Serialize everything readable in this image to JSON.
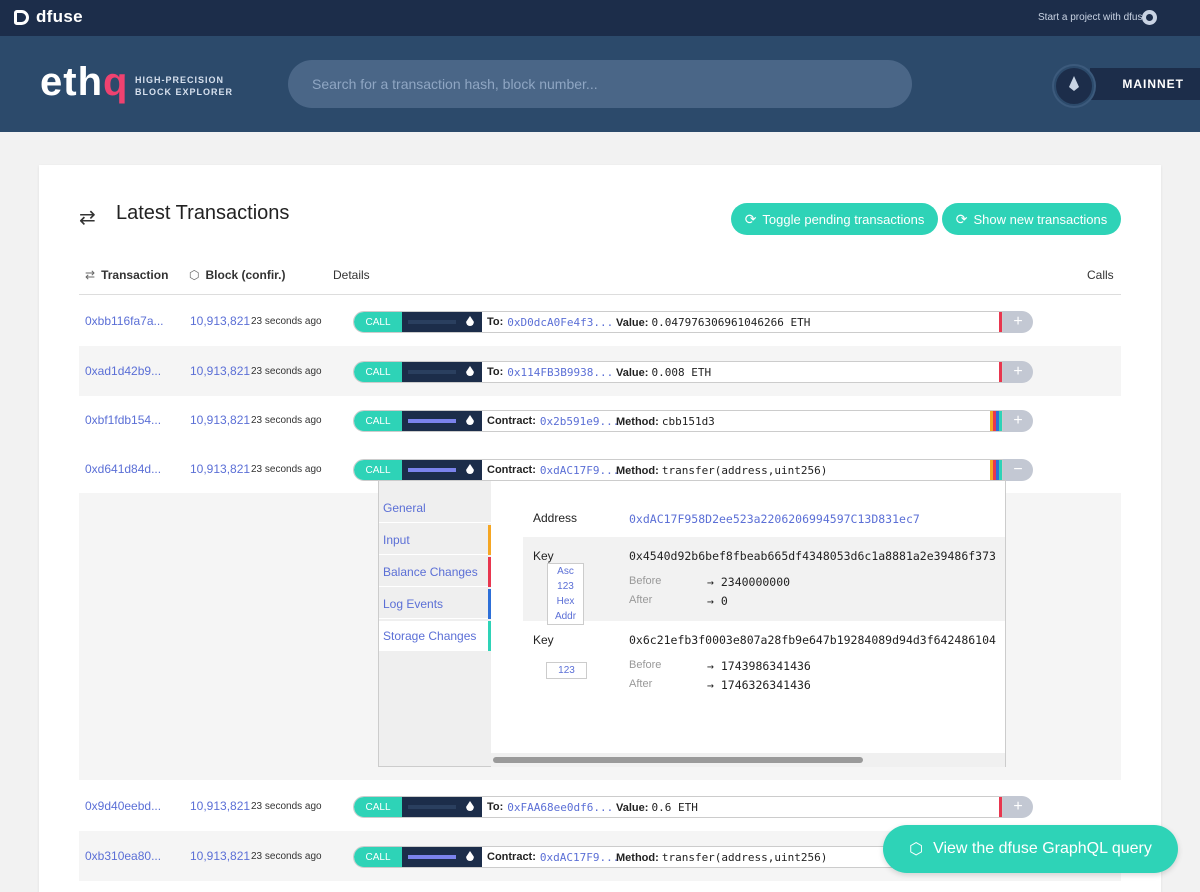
{
  "topbar": {
    "logo": "dfuse",
    "start_link": "Start a project with dfuse"
  },
  "header": {
    "brand_main": "eth",
    "brand_accent": "q",
    "tagline_1": "HIGH-PRECISION",
    "tagline_2": "BLOCK EXPLORER",
    "search_placeholder": "Search for a transaction hash, block number...",
    "network": "MAINNET"
  },
  "main": {
    "title": "Latest Transactions",
    "toggle_button": "Toggle pending transactions",
    "show_button": "Show new transactions",
    "columns": {
      "transaction": "Transaction",
      "block": "Block (confir.)",
      "details": "Details",
      "calls": "Calls"
    }
  },
  "rows": [
    {
      "tx": "0xbb116fa7a...",
      "block": "10,913,821",
      "ago": "23 seconds ago",
      "call": "CALL",
      "label1": "To:",
      "addr": "0xD0dcA0Fe4f3...",
      "label2": "Value:",
      "value": "0.047976306961046266 ETH",
      "toggle": "+"
    },
    {
      "tx": "0xad1d42b9...",
      "block": "10,913,821",
      "ago": "23 seconds ago",
      "call": "CALL",
      "label1": "To:",
      "addr": "0x114FB3B9938...",
      "label2": "Value:",
      "value": "0.008 ETH",
      "toggle": "+"
    },
    {
      "tx": "0xbf1fdb154...",
      "block": "10,913,821",
      "ago": "23 seconds ago",
      "call": "CALL",
      "label1": "Contract:",
      "addr": "0x2b591e9...",
      "label2": "Method:",
      "value": "cbb151d3",
      "toggle": "+"
    },
    {
      "tx": "0xd641d84d...",
      "block": "10,913,821",
      "ago": "23 seconds ago",
      "call": "CALL",
      "label1": "Contract:",
      "addr": "0xdAC17F9...",
      "label2": "Method:",
      "value": "transfer(address,uint256)",
      "toggle": "−"
    },
    {
      "tx": "0x9d40eebd...",
      "block": "10,913,821",
      "ago": "23 seconds ago",
      "call": "CALL",
      "label1": "To:",
      "addr": "0xFAA68ee0df6...",
      "label2": "Value:",
      "value": "0.6 ETH",
      "toggle": "+"
    },
    {
      "tx": "0xb310ea80...",
      "block": "10,913,821",
      "ago": "23 seconds ago",
      "call": "CALL",
      "label1": "Contract:",
      "addr": "0xdAC17F9...",
      "label2": "Method:",
      "value": "transfer(address,uint256)",
      "toggle": "+"
    }
  ],
  "panel": {
    "tabs": [
      "General",
      "Input",
      "Balance Changes",
      "Log Events",
      "Storage Changes"
    ],
    "address_label": "Address",
    "address": "0xdAC17F958D2ee523a2206206994597C13D831ec7",
    "key_label": "Key",
    "key1": "0x4540d92b6bef8fbeab665df4348053d6c1a8881a2e39486f373",
    "key1_formats": [
      "Asc",
      "123",
      "Hex",
      "Addr"
    ],
    "before_label": "Before",
    "after_label": "After",
    "key1_before": "→ 2340000000",
    "key1_after": "→ 0",
    "key2": "0x6c21efb3f0003e807a28fb9e647b19284089d94d3f642486104",
    "key2_format": "123",
    "key2_before": "→ 1743986341436",
    "key2_after": "→ 1746326341436"
  },
  "graphql_button": "View the dfuse GraphQL query",
  "colors": {
    "accent": "#2ed3b7",
    "navy": "#1c2d4a",
    "header": "#2c4a6b",
    "link": "#5b6fd6",
    "brand_q": "#ef4270"
  }
}
